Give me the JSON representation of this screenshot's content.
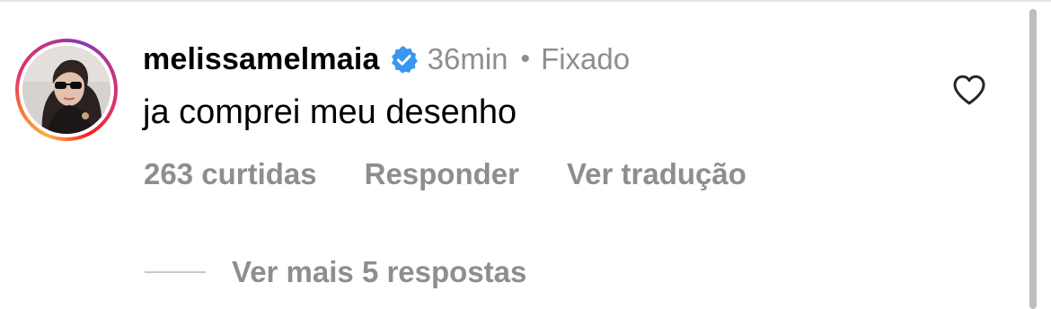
{
  "comment": {
    "username": "melissamelmaia",
    "time": "36min",
    "separator": "•",
    "pinned_label": "Fixado",
    "text": "ja comprei meu desenho",
    "likes": "263 curtidas",
    "reply_label": "Responder",
    "translate_label": "Ver tradução"
  },
  "replies": {
    "label": "Ver mais 5 respostas"
  },
  "icons": {
    "verified": "verified-badge-icon",
    "heart": "heart-outline-icon"
  },
  "colors": {
    "secondary_text": "#8e8e8e",
    "verified_blue": "#3897f0"
  }
}
